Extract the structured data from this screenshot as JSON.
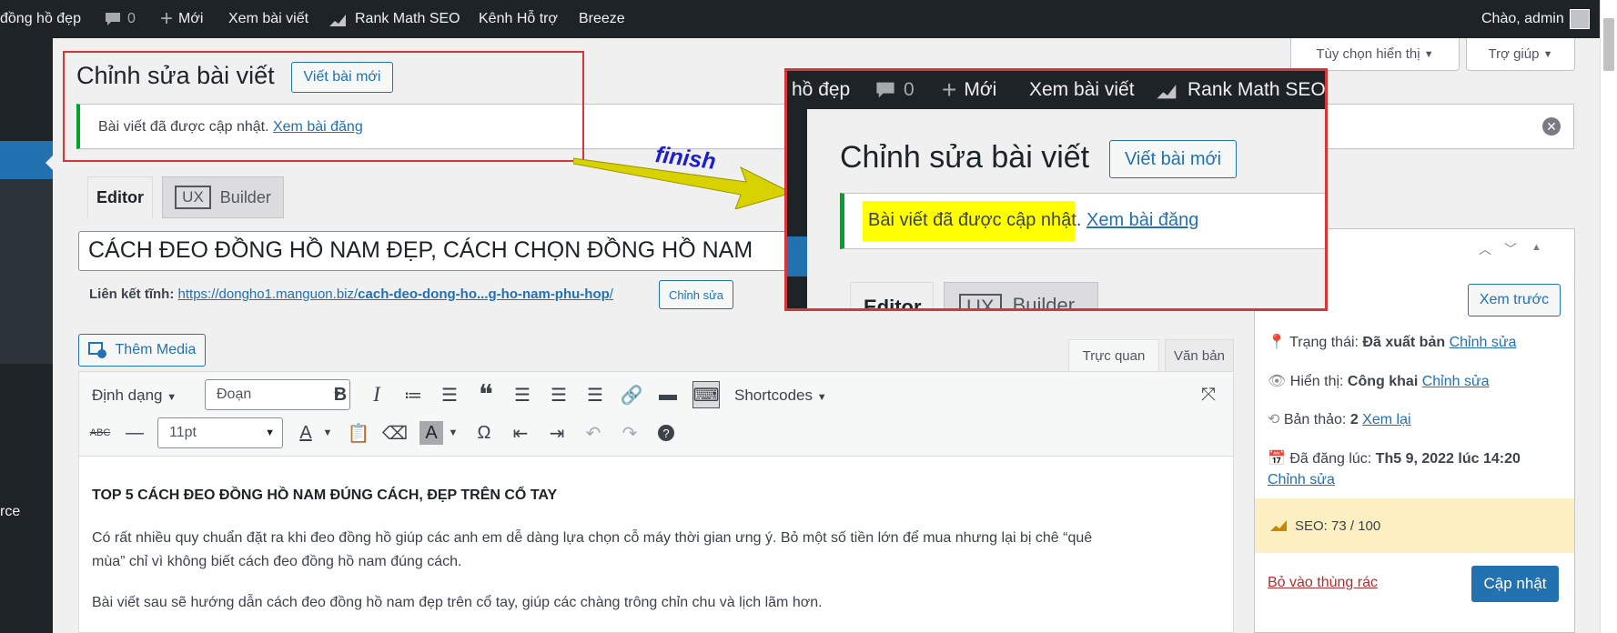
{
  "admin_bar": {
    "site_name": "đồng hồ đẹp",
    "comments_count": "0",
    "new_label": "Mới",
    "view_post": "Xem bài viết",
    "rank_math": "Rank Math SEO",
    "support": "Kênh Hỗ trợ",
    "breeze": "Breeze",
    "greeting": "Chào, admin"
  },
  "sidebar": {
    "partial_label": "rce"
  },
  "screen_options": "Tùy chọn hiển thị",
  "help": "Trợ giúp",
  "heading": "Chỉnh sửa bài viết",
  "add_new": "Viết bài mới",
  "notice": {
    "text": "Bài viết đã được cập nhật.",
    "link": "Xem bài đăng"
  },
  "tabs": {
    "editor": "Editor",
    "ux_box": "UX",
    "builder": "Builder"
  },
  "post_title": "CÁCH ĐEO ĐỒNG HỒ NAM ĐẸP, CÁCH CHỌN ĐỒNG HỒ NAM",
  "permalink": {
    "label": "Liên kết tĩnh:",
    "url_prefix": "https://dongho1.manguon.biz/",
    "url_slug": "cach-deo-dong-ho...g-ho-nam-phu-hop",
    "url_suffix": "/",
    "edit": "Chỉnh sửa"
  },
  "add_media": "Thêm Media",
  "editor_tabs": {
    "visual": "Trực quan",
    "text": "Văn bản"
  },
  "toolbar": {
    "format_menu": "Định dạng",
    "paragraph": "Đoạn",
    "shortcodes": "Shortcodes",
    "font_size": "11pt"
  },
  "content": {
    "heading": "TOP 5 CÁCH ĐEO ĐỒNG HỒ NAM ĐÚNG CÁCH, ĐẸP TRÊN CỔ TAY",
    "para1_line1": "Có rất nhiều quy chuẩn đặt ra khi đeo đồng hồ giúp các anh em dễ dàng lựa chọn cỗ máy thời gian ưng ý. Bỏ một số tiền lớn để mua nhưng lại bị chê “quê",
    "para1_line2": "mùa” chỉ vì không biết cách đeo đồng hồ nam đúng cách.",
    "para2": "Bài viết sau sẽ hướng dẫn cách đeo đồng hồ nam đẹp trên cổ tay, giúp các chàng trông chỉn chu và lịch lãm hơn."
  },
  "publish": {
    "preview": "Xem trước",
    "status_label": "Trạng thái:",
    "status_value": "Đã xuất bản",
    "status_edit": "Chỉnh sửa",
    "visibility_label": "Hiển thị:",
    "visibility_value": "Công khai",
    "visibility_edit": "Chỉnh sửa",
    "revisions_label": "Bản thảo:",
    "revisions_value": "2",
    "revisions_link": "Xem lại",
    "published_label": "Đã đăng lúc:",
    "published_value": "Th5 9, 2022 lúc 14:20",
    "published_edit": "Chỉnh sửa",
    "seo": "SEO: 73 / 100",
    "trash": "Bỏ vào thùng rác",
    "update": "Cập nhật"
  },
  "annotation": {
    "arrow_label": "finish"
  },
  "zoom": {
    "site_name": "hồ đẹp",
    "comments_count": "0",
    "new_label": "Mới",
    "view_post": "Xem bài viết",
    "rank_math": "Rank Math SEO",
    "heading": "Chỉnh sửa bài viết",
    "add_new": "Viết bài mới",
    "notice_text": "Bài viết đã được cập nhật.",
    "notice_link": "Xem bài đăng",
    "tab_editor": "Editor",
    "tab_ux": "UX",
    "tab_builder": "Builder"
  },
  "colors": {
    "admin_bar": "#1d2327",
    "accent": "#2271b1",
    "success": "#00a32a",
    "highlight": "#ffff00",
    "annotation_red": "#d63638",
    "seo_bg": "#fcf0c3"
  }
}
